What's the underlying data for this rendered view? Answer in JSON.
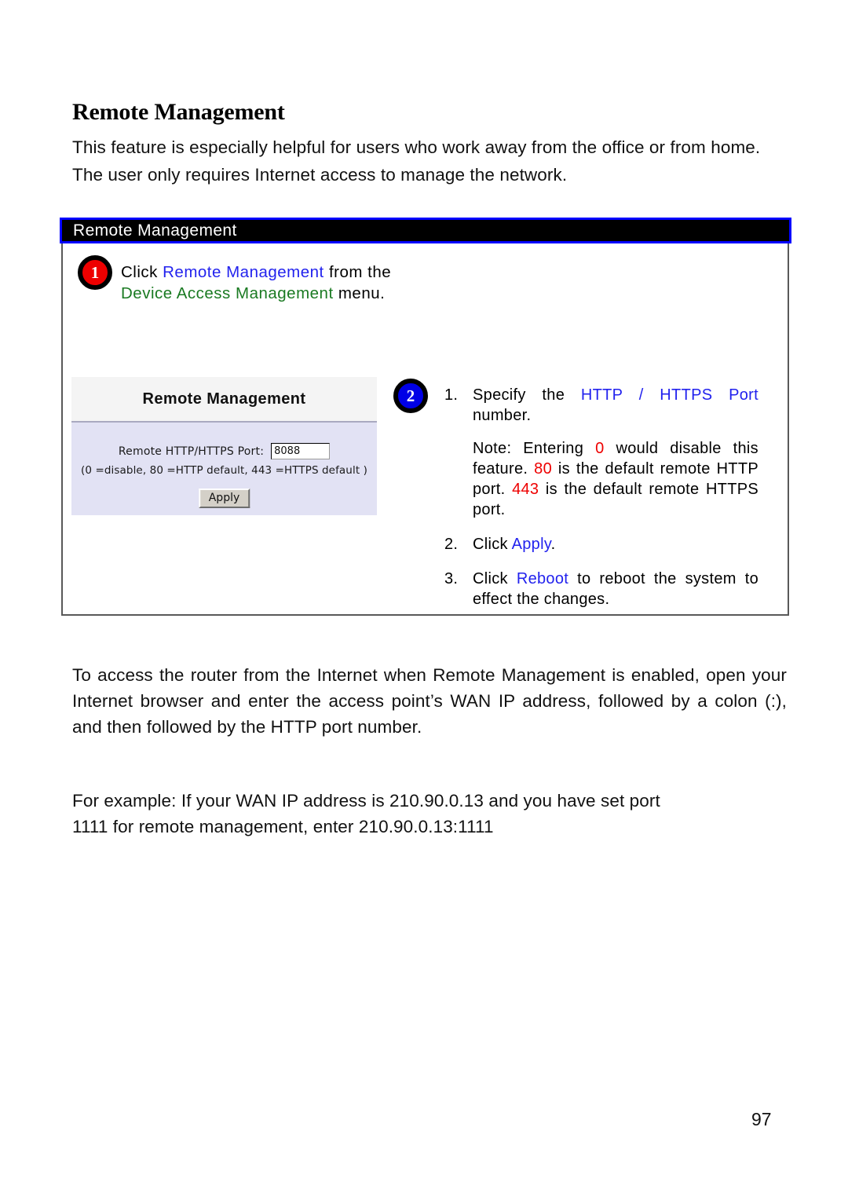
{
  "document": {
    "heading": "Remote Management",
    "intro_line_1": "This feature is especially helpful for users who work away from the office or from home.",
    "intro_line_2": "The user only requires Internet access to manage the network.",
    "page_number": "97"
  },
  "colors": {
    "link_blue": "#2222ee",
    "menu_green": "#1a7a22",
    "value_red": "#ee0000",
    "titlebar_border": "#0000ff",
    "titlebar_fill": "#000000",
    "badge_1_fill": "#ee0000",
    "badge_2_fill": "#0000e6",
    "panel_body": "#e2e2f4"
  },
  "callout": {
    "title": "Remote Management",
    "step1": {
      "badge": "1",
      "text_1": "Click ",
      "link": "Remote Management",
      "text_2": " from the ",
      "menu": "Device Access Management",
      "text_3": " menu."
    },
    "step2": {
      "badge": "2",
      "items": [
        {
          "number": "1.",
          "text_1": "Specify the ",
          "link": "HTTP / HTTPS Port",
          "text_2": " number.",
          "note": {
            "text_1": "Note: Entering ",
            "value_1": "0",
            "text_2": " would disable this feature. ",
            "value_2": "80",
            "text_3": " is the default remote HTTP port. ",
            "value_3": "443",
            "text_4": " is the default remote HTTPS port."
          }
        },
        {
          "number": "2.",
          "text_1": "Click ",
          "link": "Apply",
          "text_2": "."
        },
        {
          "number": "3.",
          "text_1": "Click ",
          "link": "Reboot",
          "text_2": " to reboot the system to effect the changes."
        }
      ]
    }
  },
  "router_panel": {
    "title": "Remote Management",
    "field_label": "Remote HTTP/HTTPS Port:",
    "field_value": "8088",
    "hint": "(0 =disable, 80 =HTTP default, 443 =HTTPS default )",
    "apply_label": "Apply"
  },
  "paragraphs": {
    "access": "To access the router from the Internet when Remote Management is enabled, open your Internet browser and enter the access point’s WAN IP address, followed by a colon (:), and then followed by the HTTP port number.",
    "example_line_1": "For example: If your WAN IP address is 210.90.0.13 and you have set port",
    "example_line_2": "1111 for remote management, enter 210.90.0.13:1111"
  }
}
